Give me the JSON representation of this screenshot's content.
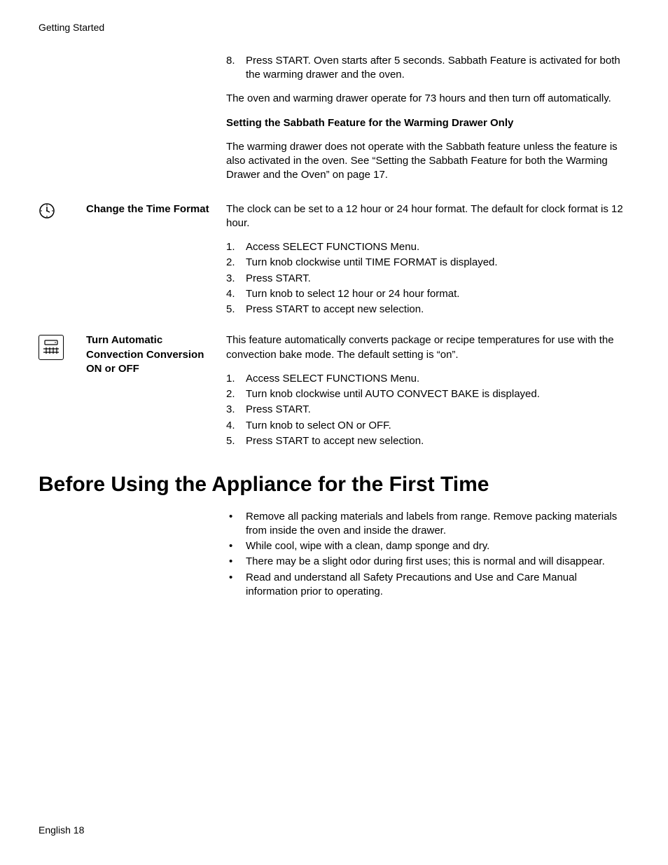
{
  "header": "Getting Started",
  "section1": {
    "step8_num": "8.",
    "step8_text": "Press START. Oven starts after 5 seconds. Sabbath Feature is activated for both the warming drawer and the oven.",
    "para1": "The oven and warming drawer operate for 73 hours and then turn off automatically.",
    "subheading": "Setting the Sabbath Feature for the Warming Drawer Only",
    "para2": "The warming drawer does not operate with the Sabbath feature unless the feature is also activated in the oven. See “Setting the Sabbath Feature for both the Warming Drawer and the Oven” on page 17."
  },
  "section2": {
    "label": "Change the Time Format",
    "intro": "The clock can be set to a 12 hour or 24 hour format. The default for clock format is 12 hour.",
    "steps": [
      "Access SELECT FUNCTIONS Menu.",
      "Turn knob clockwise until TIME FORMAT is displayed.",
      "Press START.",
      "Turn knob to select 12 hour or 24 hour format.",
      "Press START to accept new selection."
    ]
  },
  "section3": {
    "label": "Turn Automatic Convection Conversion ON or OFF",
    "intro": "This feature automatically converts package or recipe temperatures for use with the convection bake mode. The default setting is “on”.",
    "steps": [
      "Access SELECT FUNCTIONS Menu.",
      "Turn knob clockwise until AUTO CONVECT BAKE is displayed.",
      "Press START.",
      "Turn knob to select ON or OFF.",
      "Press START to accept new selection."
    ]
  },
  "heading": "Before Using the Appliance for the First Time",
  "bullets": [
    "Remove all packing materials and labels from range. Remove packing materials from inside the oven and inside the drawer.",
    "While cool, wipe with a clean, damp sponge and dry.",
    "There may be a slight odor during first uses; this is normal and will disappear.",
    "Read and understand all Safety Precautions and Use and Care Manual information prior to operating."
  ],
  "footer": "English 18"
}
